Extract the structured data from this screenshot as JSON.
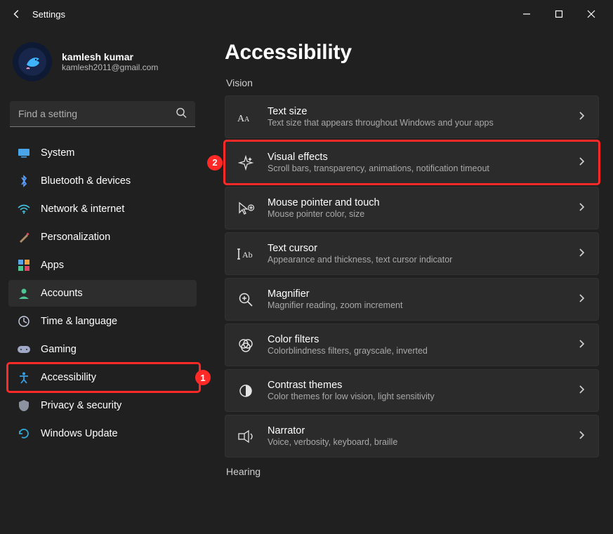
{
  "window": {
    "title": "Settings"
  },
  "profile": {
    "name": "kamlesh kumar",
    "email": "kamlesh2011@gmail.com"
  },
  "search": {
    "placeholder": "Find a setting"
  },
  "sidebar": {
    "items": [
      {
        "id": "system",
        "label": "System",
        "color": "#4aa4e8"
      },
      {
        "id": "bluetooth",
        "label": "Bluetooth & devices",
        "color": "#59a0ff"
      },
      {
        "id": "network",
        "label": "Network & internet",
        "color": "#41c0de"
      },
      {
        "id": "personalization",
        "label": "Personalization",
        "color": "#814cd4"
      },
      {
        "id": "apps",
        "label": "Apps",
        "color": "#f0a33b"
      },
      {
        "id": "accounts",
        "label": "Accounts",
        "color": "#4dc694",
        "selected": true
      },
      {
        "id": "time-language",
        "label": "Time & language",
        "color": "#c9cfe4"
      },
      {
        "id": "gaming",
        "label": "Gaming",
        "color": "#9fa8c6"
      },
      {
        "id": "accessibility",
        "label": "Accessibility",
        "color": "#3aa0e5",
        "highlighted": true,
        "highlight_badge": "1"
      },
      {
        "id": "privacy",
        "label": "Privacy & security",
        "color": "#8c929f"
      },
      {
        "id": "windows-update",
        "label": "Windows Update",
        "color": "#2fa8d6"
      }
    ]
  },
  "page": {
    "title": "Accessibility",
    "sections": [
      {
        "header": "Vision",
        "items": [
          {
            "id": "text-size",
            "title": "Text size",
            "sub": "Text size that appears throughout Windows and your apps"
          },
          {
            "id": "visual-effects",
            "title": "Visual effects",
            "sub": "Scroll bars, transparency, animations, notification timeout",
            "highlighted": true,
            "highlight_badge": "2"
          },
          {
            "id": "mouse-pointer",
            "title": "Mouse pointer and touch",
            "sub": "Mouse pointer color, size"
          },
          {
            "id": "text-cursor",
            "title": "Text cursor",
            "sub": "Appearance and thickness, text cursor indicator"
          },
          {
            "id": "magnifier",
            "title": "Magnifier",
            "sub": "Magnifier reading, zoom increment"
          },
          {
            "id": "color-filters",
            "title": "Color filters",
            "sub": "Colorblindness filters, grayscale, inverted"
          },
          {
            "id": "contrast",
            "title": "Contrast themes",
            "sub": "Color themes for low vision, light sensitivity"
          },
          {
            "id": "narrator",
            "title": "Narrator",
            "sub": "Voice, verbosity, keyboard, braille"
          }
        ]
      },
      {
        "header": "Hearing",
        "items": []
      }
    ]
  },
  "highlight_color": "#ff2a27"
}
